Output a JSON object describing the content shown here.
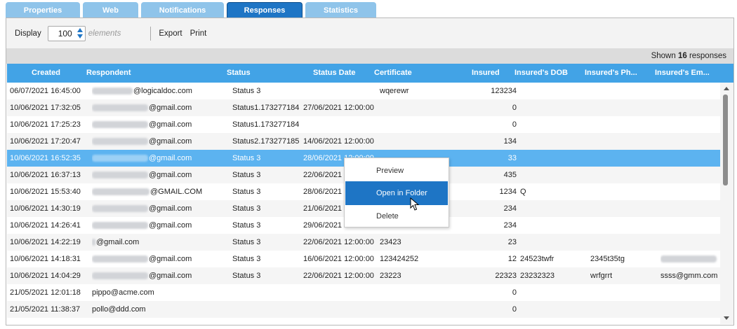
{
  "tabs": [
    {
      "label": "Properties",
      "active": false
    },
    {
      "label": "Web",
      "active": false
    },
    {
      "label": "Notifications",
      "active": false
    },
    {
      "label": "Responses",
      "active": true
    },
    {
      "label": "Statistics",
      "active": false
    }
  ],
  "toolbar": {
    "display_label": "Display",
    "display_value": "100",
    "display_suffix": "elements",
    "export_label": "Export",
    "print_label": "Print"
  },
  "summary": {
    "prefix": "Shown",
    "count": "16",
    "suffix": "responses"
  },
  "grid": {
    "columns": [
      "Created",
      "Respondent",
      "Status",
      "Status Date",
      "Certificate",
      "Insured",
      "Insured's DOB",
      "Insured's Ph...",
      "Insured's Em..."
    ],
    "selected_row": 4,
    "rows": [
      {
        "created": "06/07/2021 16:45:00",
        "respondent": "@logicaldoc.com",
        "status": "Status 3",
        "status_date": "",
        "certificate": "wqerewr",
        "insured": "123234",
        "dob": "",
        "phone": "",
        "email": ""
      },
      {
        "created": "10/06/2021 17:32:05",
        "respondent": "@gmail.com",
        "status": "Status1.173277184",
        "status_date": "27/06/2021 12:00:00",
        "certificate": "",
        "insured": "0",
        "dob": "",
        "phone": "",
        "email": ""
      },
      {
        "created": "10/06/2021 17:25:23",
        "respondent": "@gmail.com",
        "status": "Status1.173277184",
        "status_date": "",
        "certificate": "",
        "insured": "0",
        "dob": "",
        "phone": "",
        "email": ""
      },
      {
        "created": "10/06/2021 17:20:47",
        "respondent": "@gmail.com",
        "status": "Status2.173277185",
        "status_date": "14/06/2021 12:00:00",
        "certificate": "",
        "insured": "134",
        "dob": "",
        "phone": "",
        "email": ""
      },
      {
        "created": "10/06/2021 16:52:35",
        "respondent": "@gmail.com",
        "status": "Status 3",
        "status_date": "28/06/2021 12:00:00",
        "certificate": "",
        "insured": "33",
        "dob": "",
        "phone": "",
        "email": ""
      },
      {
        "created": "10/06/2021 16:37:13",
        "respondent": "@gmail.com",
        "status": "Status 3",
        "status_date": "22/06/2021",
        "certificate": "",
        "insured": "435",
        "dob": "",
        "phone": "",
        "email": ""
      },
      {
        "created": "10/06/2021 15:53:40",
        "respondent": "@GMAIL.COM",
        "status": "Status 3",
        "status_date": "28/06/2021",
        "certificate": "",
        "insured": "1234",
        "dob": "Q",
        "phone": "",
        "email": ""
      },
      {
        "created": "10/06/2021 14:30:19",
        "respondent": "@gmail.com",
        "status": "Status 3",
        "status_date": "21/06/2021",
        "certificate": "",
        "insured": "234",
        "dob": "",
        "phone": "",
        "email": ""
      },
      {
        "created": "10/06/2021 14:26:41",
        "respondent": "@gmail.com",
        "status": "Status 3",
        "status_date": "29/06/2021",
        "certificate": "",
        "insured": "234",
        "dob": "",
        "phone": "",
        "email": ""
      },
      {
        "created": "10/06/2021 14:22:19",
        "respondent": "@gmail.com",
        "status": "Status 3",
        "status_date": "22/06/2021 12:00:00",
        "certificate": "23423",
        "insured": "23",
        "dob": "",
        "phone": "",
        "email": ""
      },
      {
        "created": "10/06/2021 14:18:31",
        "respondent": "@gmail.com",
        "status": "Status 3",
        "status_date": "16/06/2021 12:00:00",
        "certificate": "123424252",
        "insured": "12",
        "dob": "24523twfr",
        "phone": "2345t35tg",
        "email": ""
      },
      {
        "created": "10/06/2021 14:04:29",
        "respondent": "@gmail.com",
        "status": "Status 3",
        "status_date": "22/06/2021 12:00:00",
        "certificate": "23223",
        "insured": "22323",
        "dob": "23232323",
        "phone": "wrfgrrt",
        "email": "ssss@gmm.com"
      },
      {
        "created": "21/05/2021 12:01:18",
        "respondent": "pippo@acme.com",
        "status": "",
        "status_date": "",
        "certificate": "",
        "insured": "0",
        "dob": "",
        "phone": "",
        "email": ""
      },
      {
        "created": "21/05/2021 11:38:37",
        "respondent": "pollo@ddd.com",
        "status": "",
        "status_date": "",
        "certificate": "",
        "insured": "0",
        "dob": "",
        "phone": "",
        "email": ""
      }
    ]
  },
  "context_menu": {
    "items": [
      {
        "label": "Preview",
        "hover": false
      },
      {
        "label": "Open in Folder",
        "hover": true
      },
      {
        "label": "Delete",
        "hover": false
      }
    ]
  }
}
